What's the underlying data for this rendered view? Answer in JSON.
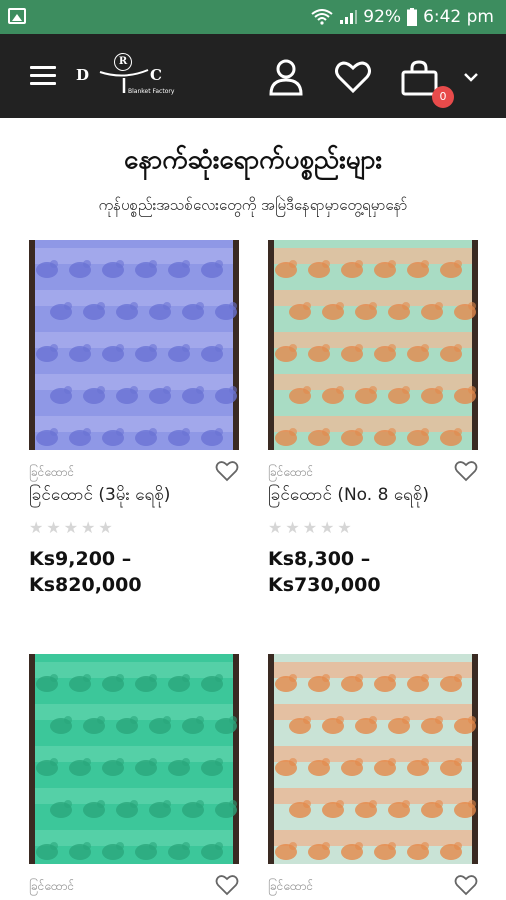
{
  "status_bar": {
    "battery": "92%",
    "time": "6:42 pm"
  },
  "header": {
    "logo": {
      "letter_left": "D",
      "letter_center": "R",
      "letter_right": "C",
      "subtitle": "Blanket Factory"
    },
    "cart_count": "0",
    "icons": [
      "menu-icon",
      "user-icon",
      "heart-icon",
      "cart-icon",
      "chevron-down-icon"
    ]
  },
  "page": {
    "title": "နောက်ဆုံးရောက်ပစ္စည်းများ",
    "subtitle": "ကုန်ပစ္စည်းအသစ်လေးတွေကို အမြဲဒီနေရာမှာတွေ့ရမှာနော်"
  },
  "products": [
    {
      "category": "ခြင်ထောင်",
      "title": "ခြင်ထောင် (3မိုး ရေစို)",
      "rating": 0,
      "price_min": "Ks9,200 –",
      "price_max": "Ks820,000",
      "colors": {
        "base": "#8f98e6",
        "pattern": "#6a73d4",
        "stripe": "#a9afec"
      }
    },
    {
      "category": "ခြင်ထောင်",
      "title": "ခြင်ထောင် (No. 8 ရေစို)",
      "rating": 0,
      "price_min": "Ks8,300 –",
      "price_max": "Ks730,000",
      "colors": {
        "base": "#a9dcc4",
        "pattern": "#e38a4d",
        "stripe": "#f2b896"
      }
    },
    {
      "category": "ခြင်ထောင်",
      "title": "",
      "rating": 0,
      "price_min": "",
      "price_max": "",
      "colors": {
        "base": "#3cc79a",
        "pattern": "#2aa67c",
        "stripe": "#5fd4ac"
      }
    },
    {
      "category": "ခြင်ထောင်",
      "title": "",
      "rating": 0,
      "price_min": "",
      "price_max": "",
      "colors": {
        "base": "#c9e3d6",
        "pattern": "#e5884a",
        "stripe": "#f0b08b"
      }
    }
  ]
}
